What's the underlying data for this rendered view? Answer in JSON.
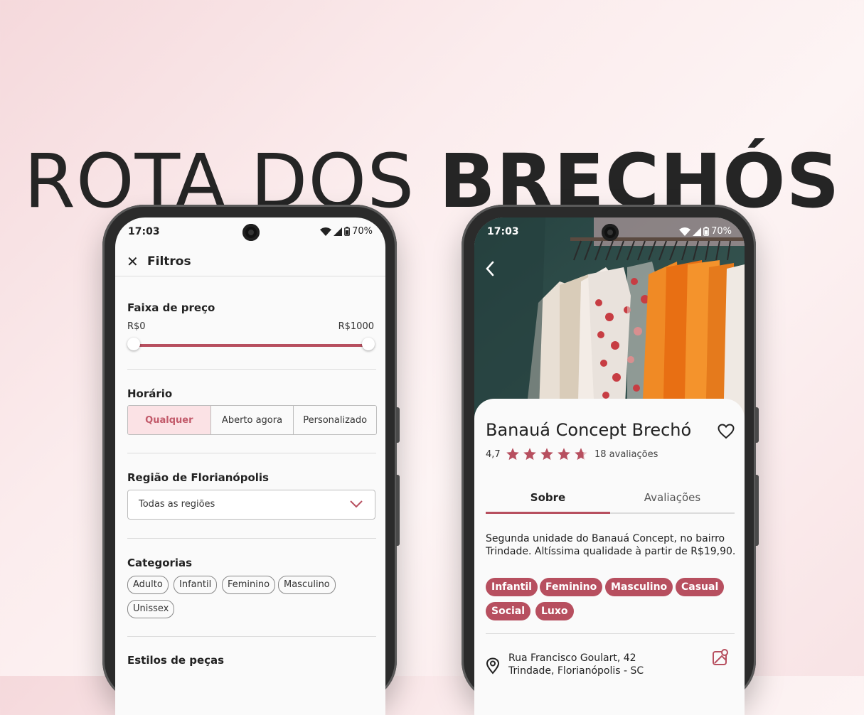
{
  "hero": {
    "title_light": "ROTA DOS",
    "title_bold": "BRECHÓS"
  },
  "status_bar": {
    "time": "17:03",
    "battery": "70%"
  },
  "filters": {
    "title": "Filtros",
    "price": {
      "label": "Faixa de preço",
      "min_label": "R$0",
      "max_label": "R$1000",
      "min_fraction": 0.0,
      "max_fraction": 1.0
    },
    "hours": {
      "label": "Horário",
      "options": [
        "Qualquer",
        "Aberto agora",
        "Personalizado"
      ],
      "selected": "Qualquer"
    },
    "region": {
      "label": "Região de Florianópolis",
      "selected": "Todas as regiões"
    },
    "categories": {
      "label": "Categorias",
      "items": [
        "Adulto",
        "Infantil",
        "Feminino",
        "Masculino",
        "Unissex"
      ]
    },
    "styles": {
      "label": "Estilos de peças"
    }
  },
  "store": {
    "name": "Banauá Concept Brechó",
    "rating": "4,7",
    "rating_value": 4.7,
    "reviews": "18 avaliações",
    "tabs": [
      "Sobre",
      "Avaliações"
    ],
    "active_tab": "Sobre",
    "description": "Segunda unidade do Banauá Concept, no bairro Trindade. Altíssima qualidade à partir de R$19,90.",
    "tags": [
      "Infantil",
      "Feminino",
      "Masculino",
      "Casual",
      "Social",
      "Luxo"
    ],
    "address_line1": "Rua Francisco Goulart, 42",
    "address_line2": "Trindade, Florianópolis - SC"
  },
  "colors": {
    "accent": "#b74f5f",
    "accent_light": "#fbe2e5"
  },
  "icons": [
    "close-icon",
    "chevron-down-icon",
    "back-arrow-icon",
    "heart-icon",
    "star-icon",
    "location-pin-icon",
    "map-icon",
    "wifi-icon",
    "signal-icon",
    "battery-icon"
  ]
}
